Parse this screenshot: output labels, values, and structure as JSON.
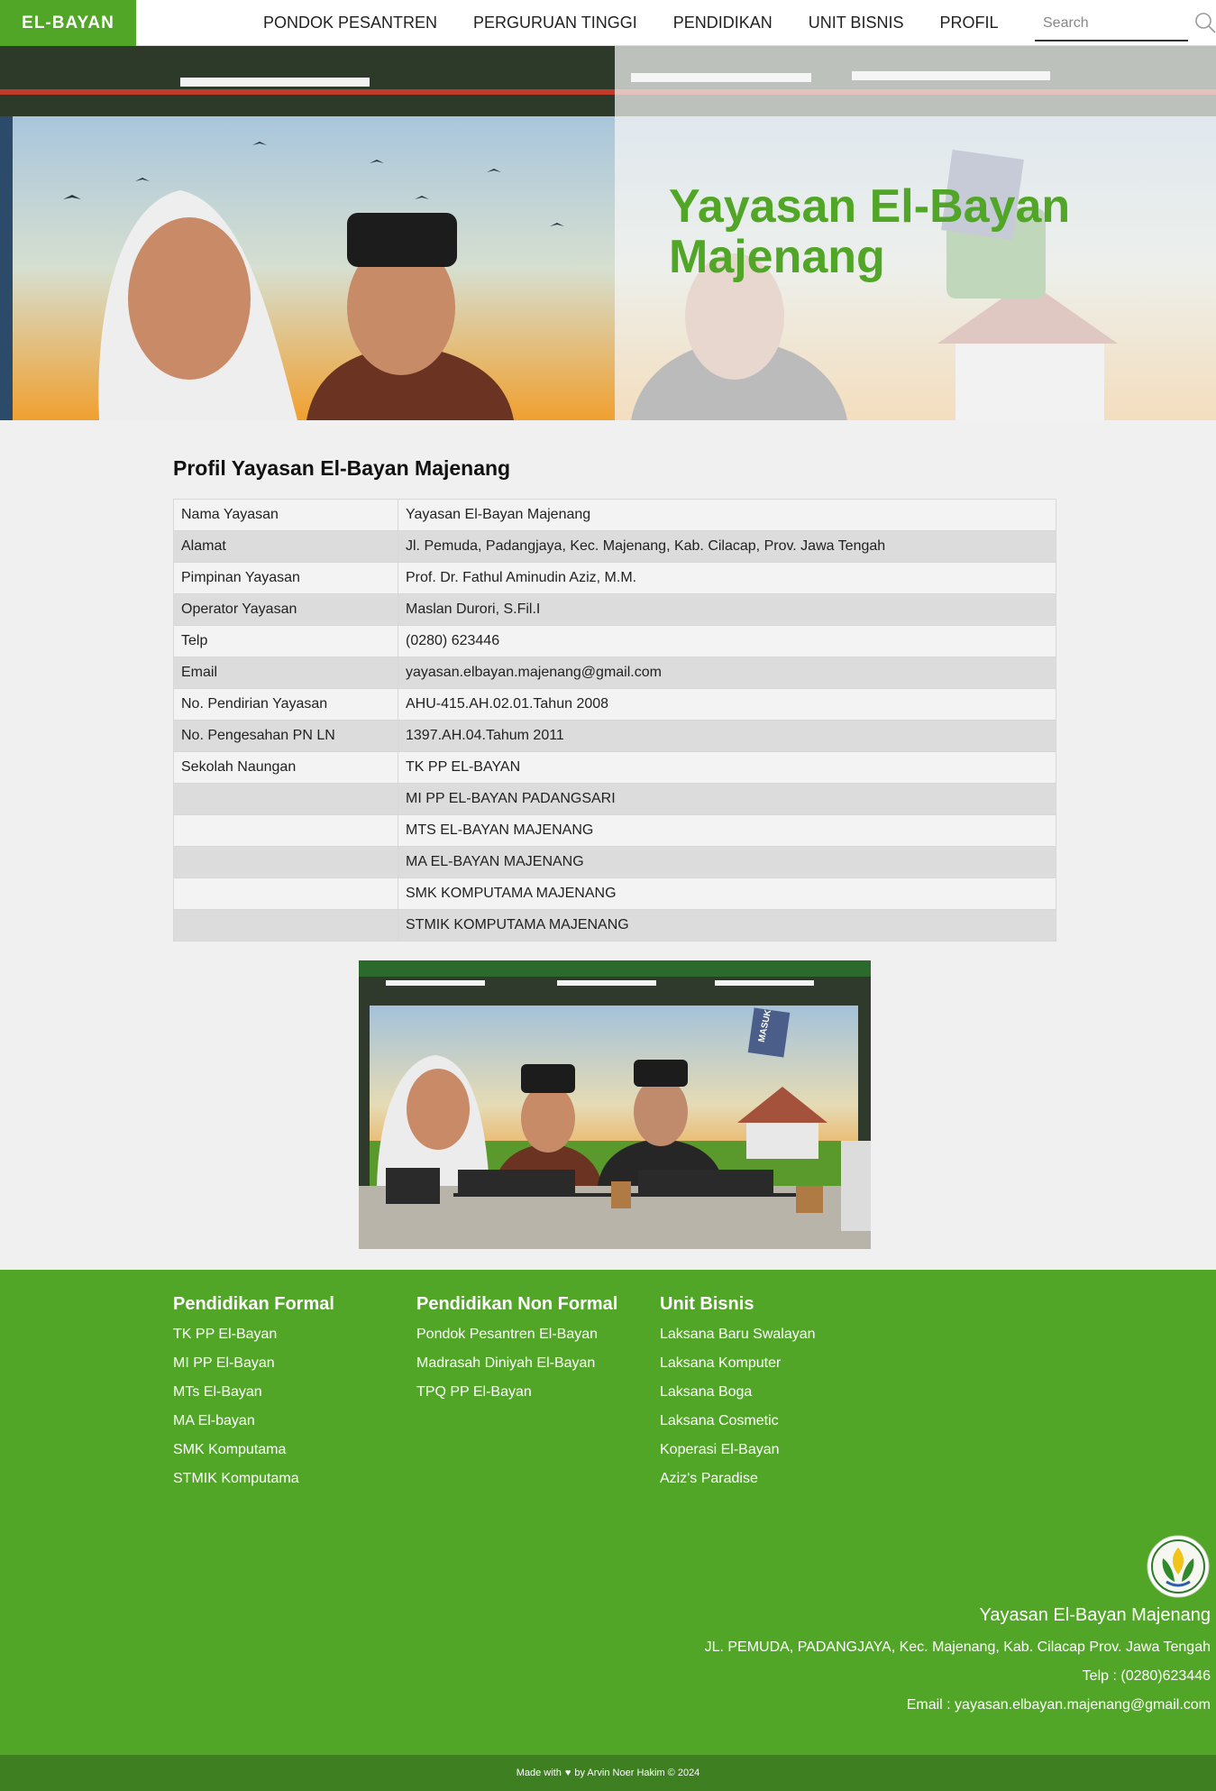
{
  "nav": {
    "brand": "EL-BAYAN",
    "links": [
      "PONDOK PESANTREN",
      "PERGURUAN TINGGI",
      "PENDIDIKAN",
      "UNIT BISNIS",
      "PROFIL"
    ],
    "search_placeholder": "Search"
  },
  "hero": {
    "title": "Yayasan El-Bayan Majenang"
  },
  "profile": {
    "title": "Profil Yayasan El-Bayan Majenang",
    "rows": [
      {
        "label": "Nama Yayasan",
        "value": "Yayasan El-Bayan Majenang"
      },
      {
        "label": "Alamat",
        "value": "Jl. Pemuda, Padangjaya, Kec. Majenang, Kab. Cilacap, Prov. Jawa Tengah"
      },
      {
        "label": "Pimpinan Yayasan",
        "value": "Prof. Dr. Fathul Aminudin Aziz, M.M."
      },
      {
        "label": "Operator Yayasan",
        "value": "Maslan Durori, S.Fil.I"
      },
      {
        "label": "Telp",
        "value": "(0280) 623446"
      },
      {
        "label": "Email",
        "value": "yayasan.elbayan.majenang@gmail.com"
      },
      {
        "label": "No. Pendirian Yayasan",
        "value": "AHU-415.AH.02.01.Tahun 2008"
      },
      {
        "label": "No. Pengesahan PN LN",
        "value": "1397.AH.04.Tahum 2011"
      },
      {
        "label": "Sekolah Naungan",
        "value": "TK PP EL-BAYAN"
      },
      {
        "label": "",
        "value": "MI PP EL-BAYAN PADANGSARI"
      },
      {
        "label": "",
        "value": "MTS EL-BAYAN MAJENANG"
      },
      {
        "label": "",
        "value": "MA EL-BAYAN MAJENANG"
      },
      {
        "label": "",
        "value": "SMK KOMPUTAMA MAJENANG"
      },
      {
        "label": "",
        "value": "STMIK KOMPUTAMA MAJENANG"
      }
    ],
    "mural_sign": "MASUK"
  },
  "footer": {
    "formal": {
      "title": "Pendidikan Formal",
      "links": [
        "TK PP El-Bayan",
        "MI PP El-Bayan",
        "MTs El-Bayan",
        "MA El-bayan",
        "SMK Komputama",
        "STMIK Komputama"
      ]
    },
    "nonformal": {
      "title": "Pendidikan Non Formal",
      "links": [
        "Pondok Pesantren El-Bayan",
        "Madrasah Diniyah El-Bayan",
        "TPQ PP El-Bayan"
      ]
    },
    "bisnis": {
      "title": "Unit Bisnis",
      "links": [
        "Laksana Baru Swalayan",
        "Laksana Komputer",
        "Laksana Boga",
        "Laksana Cosmetic",
        "Koperasi El-Bayan",
        "Aziz's Paradise"
      ]
    },
    "org_name": "Yayasan El-Bayan Majenang",
    "address": "JL. PEMUDA, PADANGJAYA, Kec. Majenang, Kab. Cilacap Prov. Jawa Tengah",
    "telp": "Telp : (0280)623446",
    "email": "Email : yayasan.elbayan.majenang@gmail.com",
    "credit_prefix": "Made with",
    "credit_suffix": "by Arvin Noer Hakim © 2024"
  },
  "colors": {
    "accent": "#52a627",
    "footer_bar": "#3e7f22"
  }
}
